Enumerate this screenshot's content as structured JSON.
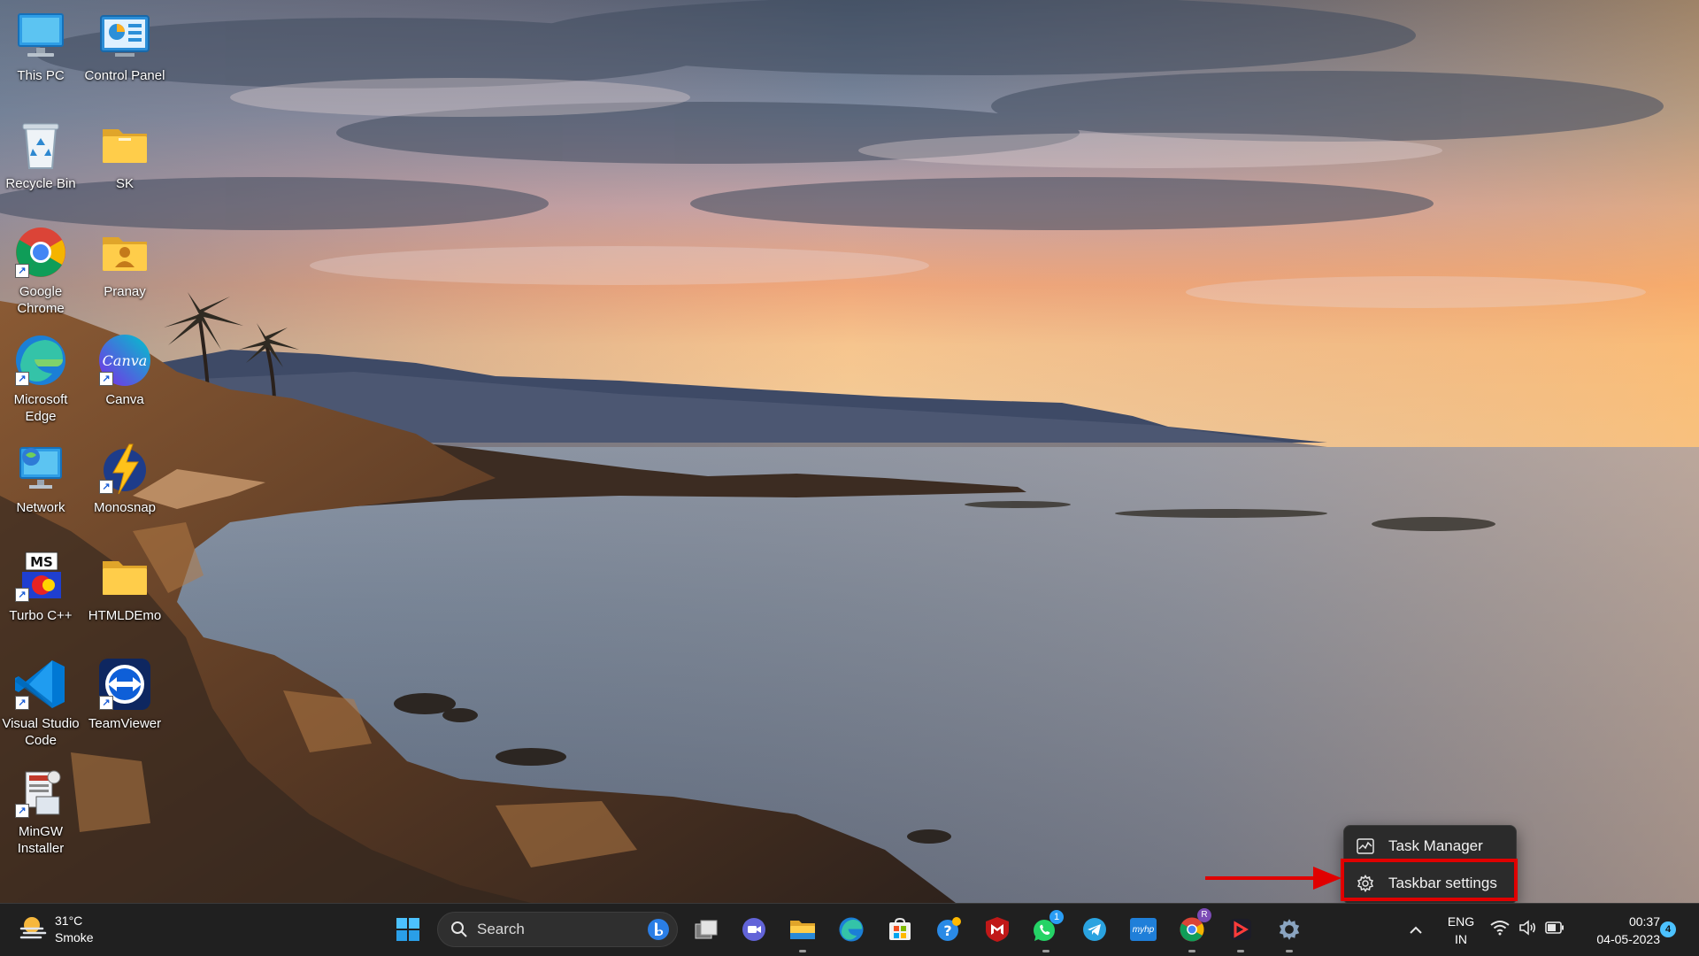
{
  "desktop": {
    "icons": [
      {
        "label": "This PC",
        "icon": "monitor-icon"
      },
      {
        "label": "Control Panel",
        "icon": "control-panel-icon"
      },
      {
        "label": "Recycle Bin",
        "icon": "recycle-bin-icon"
      },
      {
        "label": "SK",
        "icon": "folder-icon"
      },
      {
        "label": "Google Chrome",
        "icon": "chrome-icon"
      },
      {
        "label": "Pranay",
        "icon": "user-folder-icon"
      },
      {
        "label": "Microsoft Edge",
        "icon": "edge-icon"
      },
      {
        "label": "Canva",
        "icon": "canva-icon"
      },
      {
        "label": "Network",
        "icon": "network-icon"
      },
      {
        "label": "Monosnap",
        "icon": "monosnap-icon"
      },
      {
        "label": "Turbo C++",
        "icon": "turbo-cpp-icon"
      },
      {
        "label": "HTMLDEmo",
        "icon": "folder-icon"
      },
      {
        "label": "Visual Studio Code",
        "icon": "vscode-icon"
      },
      {
        "label": "TeamViewer",
        "icon": "teamviewer-icon"
      },
      {
        "label": "MinGW Installer",
        "icon": "installer-icon"
      }
    ],
    "canva_logo_text": "Canva",
    "turbo_logo_text": "MS"
  },
  "context_menu": {
    "items": [
      {
        "label": "Task Manager",
        "icon": "task-manager-icon"
      },
      {
        "label": "Taskbar settings",
        "icon": "gear-icon",
        "highlighted": true
      }
    ]
  },
  "taskbar": {
    "weather": {
      "temp": "31°C",
      "condition": "Smoke"
    },
    "search": {
      "placeholder": "Search"
    },
    "apps": [
      {
        "name": "start-button",
        "icon": "windows-logo-icon"
      },
      {
        "name": "task-view",
        "icon": "task-view-icon"
      },
      {
        "name": "teams-chat",
        "icon": "camera-chat-icon"
      },
      {
        "name": "file-explorer",
        "icon": "folder-icon"
      },
      {
        "name": "edge",
        "icon": "edge-icon"
      },
      {
        "name": "store",
        "icon": "store-icon"
      },
      {
        "name": "get-help",
        "icon": "help-icon"
      },
      {
        "name": "mcafee",
        "icon": "mcafee-icon"
      },
      {
        "name": "whatsapp",
        "icon": "whatsapp-icon",
        "badge": "1"
      },
      {
        "name": "telegram",
        "icon": "telegram-icon"
      },
      {
        "name": "myhp",
        "icon": "myhp-icon",
        "label": "myhp"
      },
      {
        "name": "chrome",
        "icon": "chrome-icon",
        "badge": "R"
      },
      {
        "name": "screen-recorder",
        "icon": "recorder-icon"
      },
      {
        "name": "settings",
        "icon": "gear-icon"
      }
    ],
    "tray": {
      "lang_line1": "ENG",
      "lang_line2": "IN",
      "time": "00:37",
      "date": "04-05-2023",
      "notifications": "4"
    }
  },
  "colors": {
    "taskbar_bg": "#202020",
    "menu_bg": "#2b2b2b",
    "highlight": "#e00000",
    "accent": "#0078d4"
  }
}
